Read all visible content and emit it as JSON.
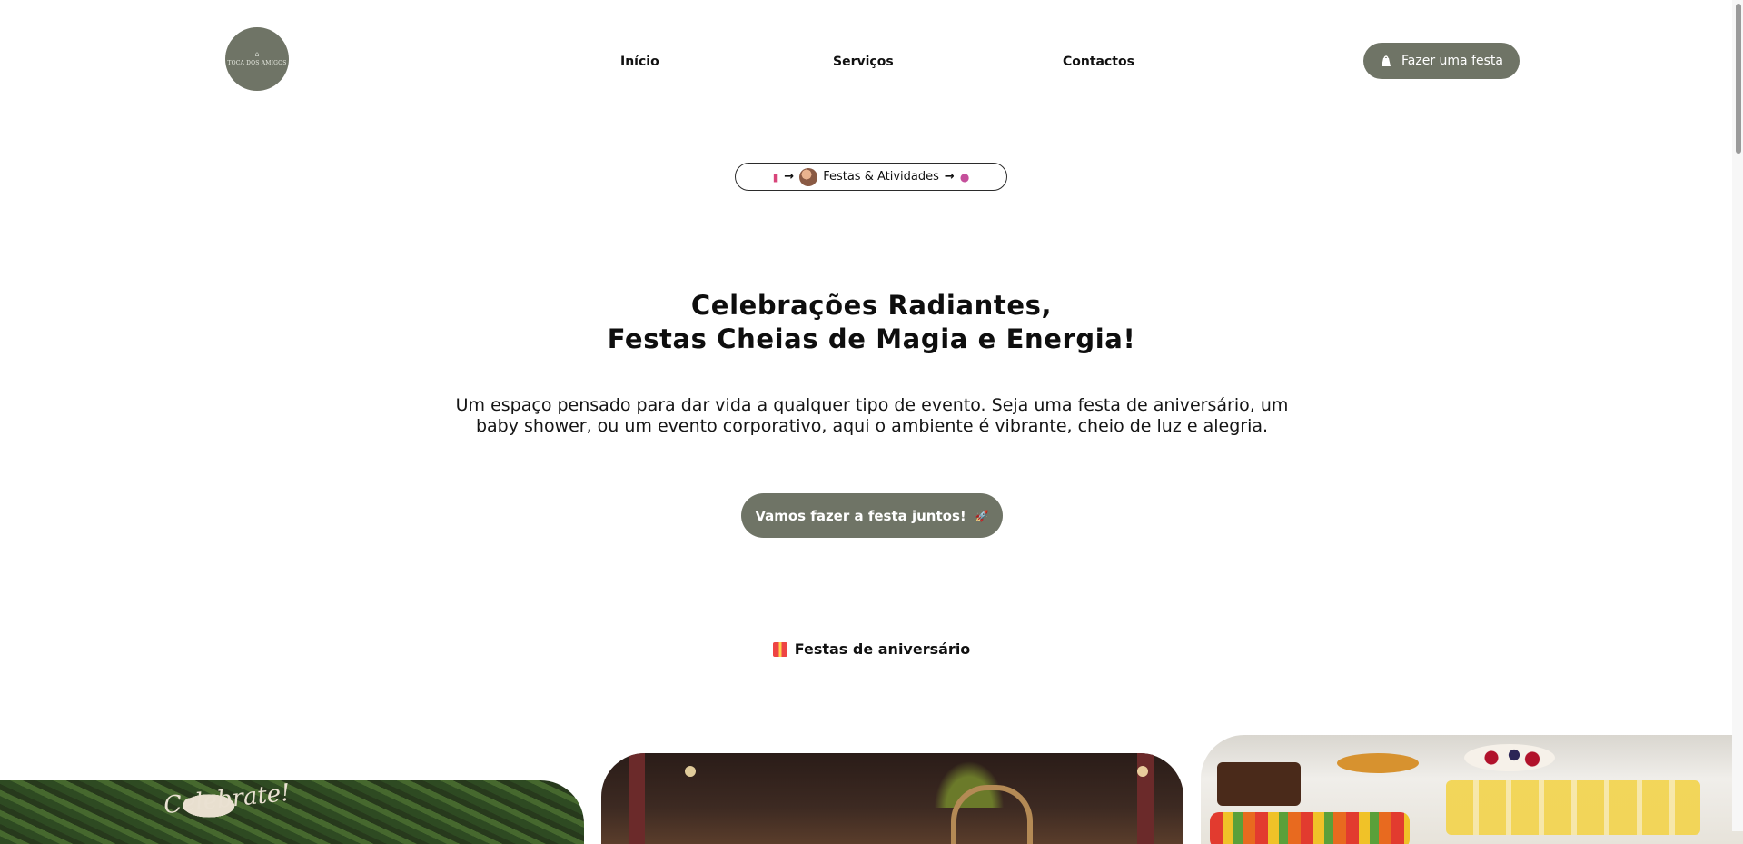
{
  "header": {
    "logo": {
      "mark": "⌂",
      "name": "TOCA DOS AMIGOS",
      "tag": ""
    },
    "nav": [
      {
        "label": "Início"
      },
      {
        "label": "Serviços"
      },
      {
        "label": "Contactos"
      }
    ],
    "cta_label": "Fazer uma festa"
  },
  "hero": {
    "pill": {
      "label": "Festas & Atividades"
    },
    "headline_line1": "Celebrações Radiantes,",
    "headline_line2": "Festas Cheias de Magia e Energia!",
    "description": "Um espaço pensado para dar vida a qualquer tipo de evento. Seja uma festa de aniversário, um baby shower, ou um evento corporativo, aqui o ambiente é vibrante, cheio de luz e alegria.",
    "cta_label": "Vamos fazer a festa juntos!",
    "cta_icon": "🚀"
  },
  "section": {
    "label": "Festas de aniversário"
  },
  "gallery": {
    "photo_1_text": "Celebrate!"
  },
  "colors": {
    "accent": "#6f7466",
    "text": "#111111",
    "background": "#ffffff"
  },
  "icons": [
    "drink-icon",
    "arrow-right-icon",
    "avatar",
    "lollipop-icon",
    "gift-icon",
    "party-bag-icon",
    "rocket-icon"
  ]
}
